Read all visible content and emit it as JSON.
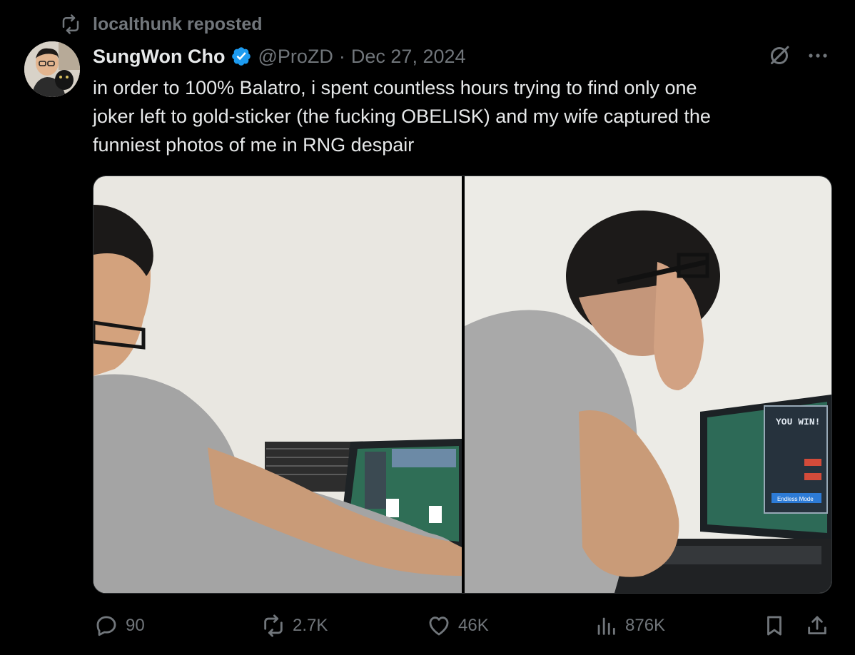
{
  "repost": {
    "text": "localthunk reposted",
    "icon": "repost-icon"
  },
  "author": {
    "display_name": "SungWon Cho",
    "verified": true,
    "handle": "@ProZD",
    "separator": "·",
    "date": "Dec 27, 2024"
  },
  "tweet": {
    "lines": [
      "in order to 100% Balatro, i spent countless hours trying to find only one",
      "joker left to gold-sticker (the fucking OBELISK) and my wife captured the",
      "funniest photos of me in RNG despair"
    ]
  },
  "media": [
    {
      "name": "photo-1"
    },
    {
      "name": "photo-2",
      "screen_text": "YOU WIN!",
      "button_text": "Endless Mode"
    }
  ],
  "actions": {
    "replies": "90",
    "reposts": "2.7K",
    "likes": "46K",
    "views": "876K"
  },
  "colors": {
    "background": "#000000",
    "text": "#e7e9ea",
    "muted": "#71767b",
    "verified": "#1d9bf0"
  }
}
